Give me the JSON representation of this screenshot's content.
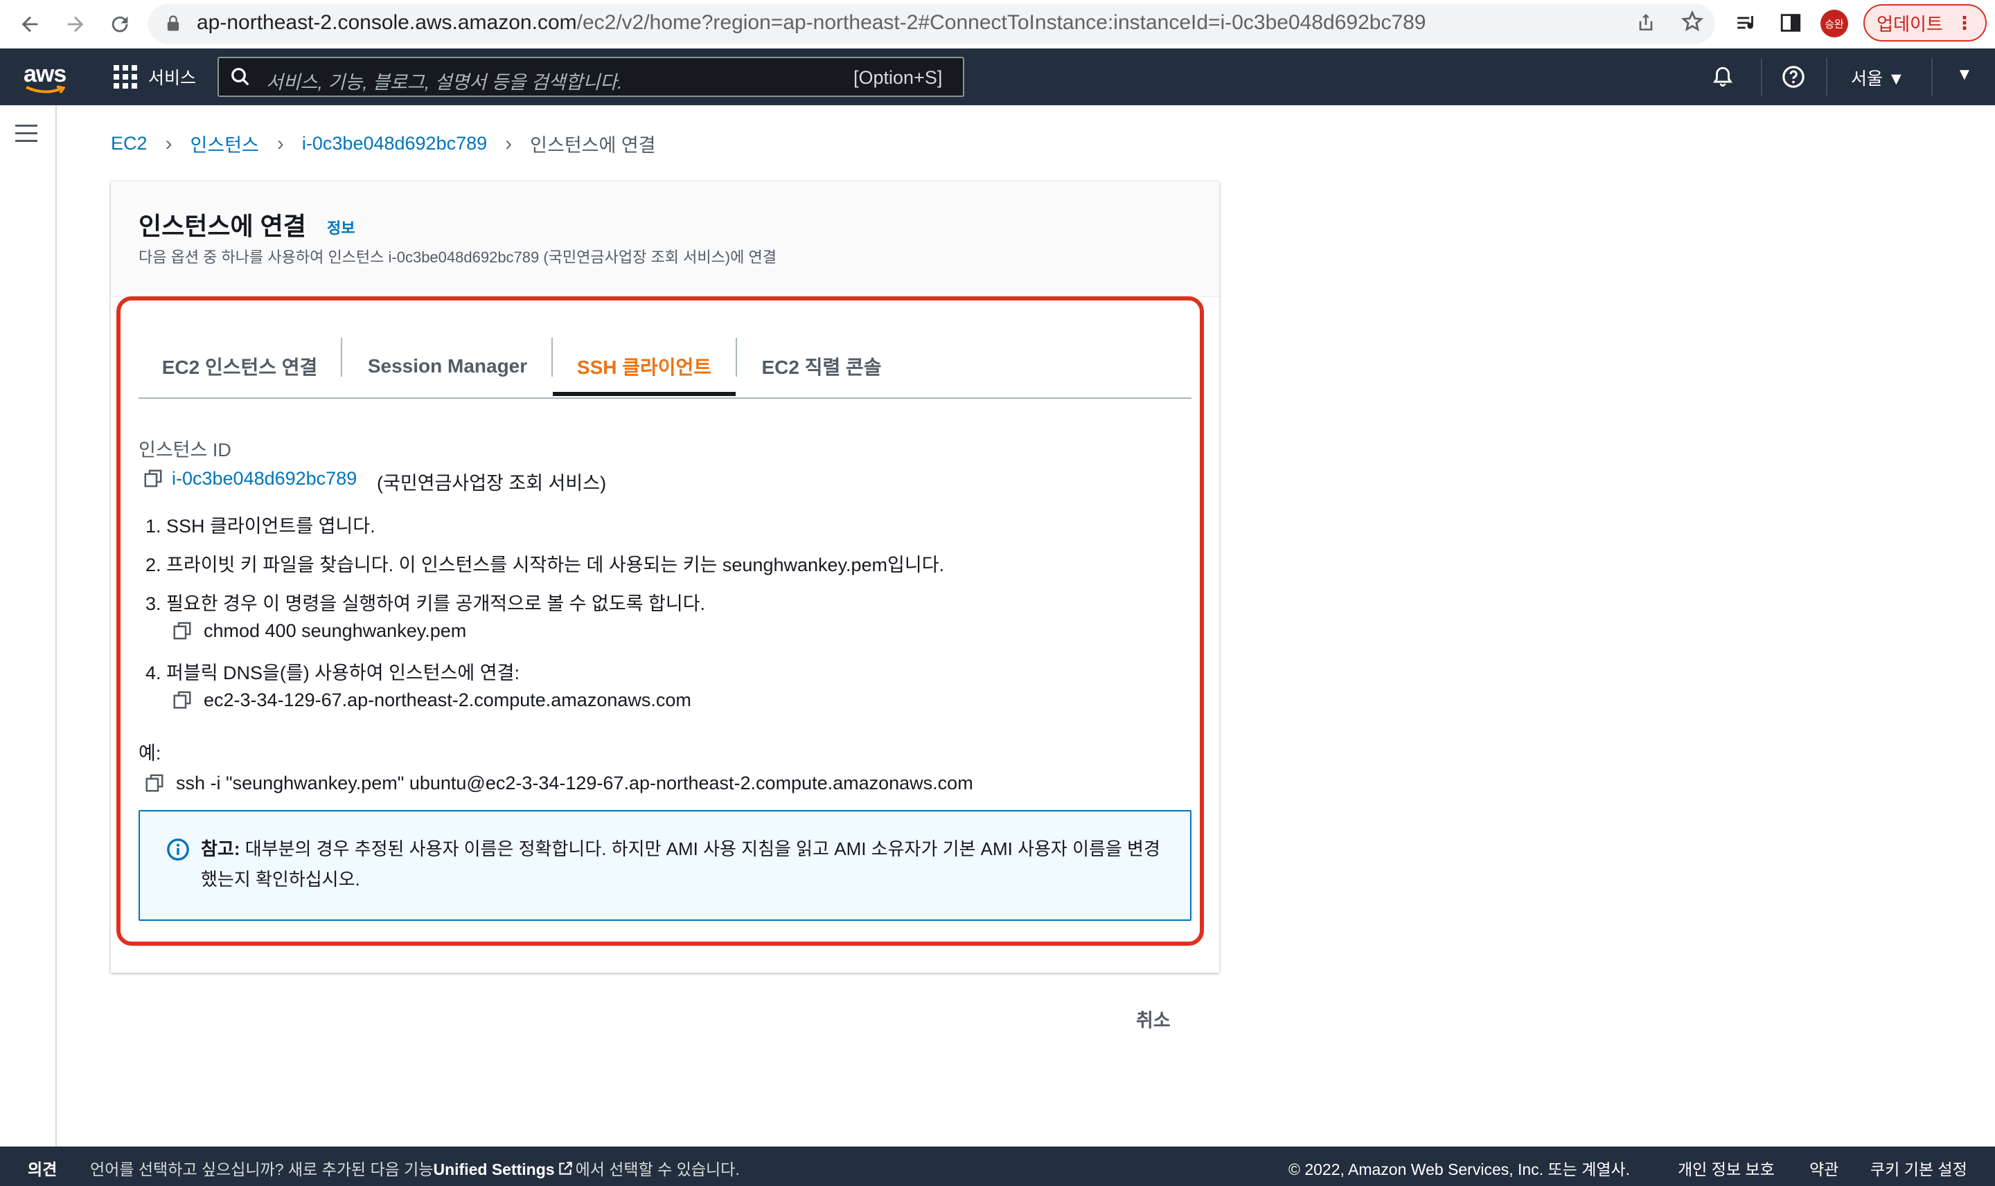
{
  "browser": {
    "url_host": "ap-northeast-2.console.aws.amazon.com",
    "url_rest": "/ec2/v2/home?region=ap-northeast-2#ConnectToInstance:instanceId=i-0c3be048d692bc789",
    "profile_label": "승완",
    "update_label": "업데이트",
    "icons": [
      "back-icon",
      "forward-icon",
      "reload-icon",
      "site-info-icon",
      "share-icon",
      "bookmark-star-icon",
      "reading-list-icon",
      "side-panel-icon",
      "menu-kebab-icon"
    ]
  },
  "aws_nav": {
    "logo": "aws",
    "services_label": "서비스",
    "search_placeholder": "서비스, 기능, 블로그, 설명서 등을 검색합니다.",
    "search_shortcut": "[Option+S]",
    "region_label": "서울 ▼",
    "account_caret": "▼"
  },
  "breadcrumb": {
    "items": [
      "EC2",
      "인스턴스",
      "i-0c3be048d692bc789"
    ],
    "current": "인스턴스에 연결"
  },
  "panel": {
    "title": "인스턴스에 연결",
    "info_link": "정보",
    "description": "다음 옵션 중 하나를 사용하여 인스턴스 i-0c3be048d692bc789 (국민연금사업장 조회 서비스)에 연결"
  },
  "tabs": [
    {
      "label": "EC2 인스턴스 연결"
    },
    {
      "label": "Session Manager"
    },
    {
      "label": "SSH 클라이언트"
    },
    {
      "label": "EC2 직렬 콘솔"
    }
  ],
  "active_tab": "SSH 클라이언트",
  "ssh": {
    "instance_id_label": "인스턴스 ID",
    "instance_id": "i-0c3be048d692bc789",
    "instance_name": "(국민연금사업장 조회 서비스)",
    "steps": [
      "1. SSH 클라이언트를 엽니다.",
      "2. 프라이빗 키 파일을 찾습니다. 이 인스턴스를 시작하는 데 사용되는 키는 seunghwankey.pem입니다.",
      "3. 필요한 경우 이 명령을 실행하여 키를 공개적으로 볼 수 없도록 합니다.",
      "4. 퍼블릭 DNS을(를) 사용하여 인스턴스에 연결:"
    ],
    "chmod_command": "chmod 400 seunghwankey.pem",
    "public_dns": "ec2-3-34-129-67.ap-northeast-2.compute.amazonaws.com",
    "example_label": "예:",
    "example_command": "ssh -i \"seunghwankey.pem\" ubuntu@ec2-3-34-129-67.ap-northeast-2.compute.amazonaws.com",
    "note_bold": "참고:",
    "note_text": " 대부분의 경우 추정된 사용자 이름은 정확합니다. 하지만 AMI 사용 지침을 읽고 AMI 소유자가 기본 AMI 사용자 이름을 변경했는지 확인하십시오."
  },
  "cancel_label": "취소",
  "footer": {
    "feedback": "의견",
    "language_prompt": "언어를 선택하고 싶으십니까? 새로 추가된 다음 기능",
    "unified_settings": "Unified Settings",
    "language_suffix": "에서 선택할 수 있습니다.",
    "copyright": "© 2022, Amazon Web Services, Inc. 또는 계열사.",
    "privacy": "개인 정보 보호",
    "terms": "약관",
    "cookie": "쿠키 기본 설정"
  },
  "colors": {
    "aws_nav": "#232f3e",
    "link": "#0073bb",
    "active_tab": "#ec7211",
    "highlight": "#e0301e"
  }
}
